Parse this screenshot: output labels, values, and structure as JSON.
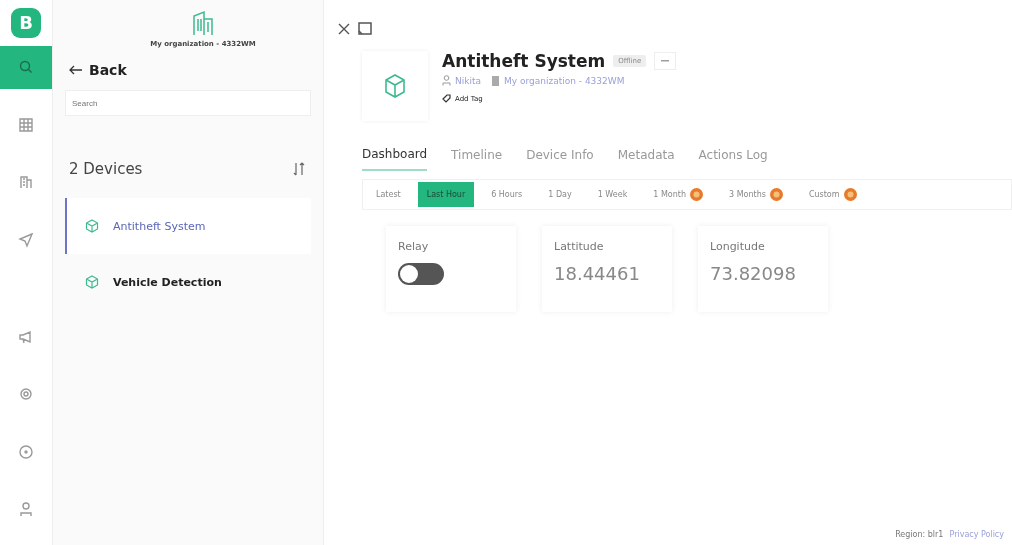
{
  "rail": {
    "logo": "B",
    "items": [
      {
        "selected": true
      },
      {
        "selected": false
      },
      {
        "selected": false
      },
      {
        "selected": false
      },
      {
        "selected": false
      },
      {
        "selected": false
      },
      {
        "selected": false
      },
      {
        "selected": false
      }
    ]
  },
  "sidebar": {
    "organization": "My organization - 4332WM",
    "back": "Back",
    "search": {
      "placeholder": "Search"
    },
    "count": "2 Devices",
    "devices": [
      {
        "name": "Antitheft System",
        "selected": true
      },
      {
        "name": "Vehicle Detection",
        "selected": false
      }
    ]
  },
  "device": {
    "name": "Antitheft System",
    "status": "Offline",
    "owner": "Nikita",
    "organization": "My organization - 4332WM",
    "add_tag": "Add Tag"
  },
  "tabs": [
    {
      "label": "Dashboard",
      "selected": true
    },
    {
      "label": "Timeline",
      "selected": false
    },
    {
      "label": "Device Info",
      "selected": false
    },
    {
      "label": "Metadata",
      "selected": false
    },
    {
      "label": "Actions Log",
      "selected": false
    }
  ],
  "ranges": [
    {
      "label": "Latest",
      "selected": false,
      "premium": false
    },
    {
      "label": "Last Hour",
      "selected": true,
      "premium": false
    },
    {
      "label": "6 Hours",
      "selected": false,
      "premium": false
    },
    {
      "label": "1 Day",
      "selected": false,
      "premium": false
    },
    {
      "label": "1 Week",
      "selected": false,
      "premium": false
    },
    {
      "label": "1 Month",
      "selected": false,
      "premium": true
    },
    {
      "label": "3 Months",
      "selected": false,
      "premium": true
    },
    {
      "label": "Custom",
      "selected": false,
      "premium": true
    }
  ],
  "widgets": [
    {
      "kind": "switch",
      "title": "Relay",
      "on": false
    },
    {
      "kind": "value",
      "title": "Lattitude",
      "value": "18.44461"
    },
    {
      "kind": "value",
      "title": "Longitude",
      "value": "73.82098"
    }
  ],
  "footer": {
    "region": "Region: blr1",
    "privacy": "Privacy Policy"
  }
}
